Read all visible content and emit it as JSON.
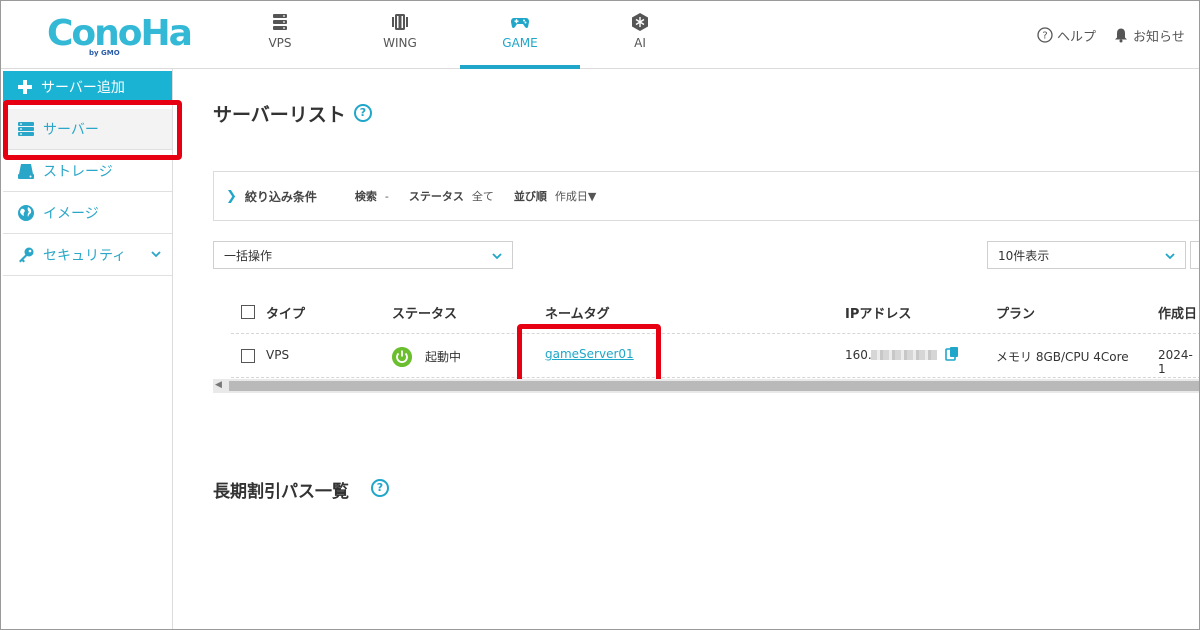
{
  "header": {
    "logo_text": "ConoHa",
    "logo_sub": "by GMO",
    "tabs": [
      {
        "label": "VPS",
        "icon": "server-stack-icon"
      },
      {
        "label": "WING",
        "icon": "wing-server-icon"
      },
      {
        "label": "GAME",
        "icon": "gamepad-icon",
        "active": true
      },
      {
        "label": "AI",
        "icon": "ai-chip-icon"
      }
    ],
    "help_label": "ヘルプ",
    "notice_label": "お知らせ"
  },
  "sidebar": {
    "add_server": "サーバー追加",
    "items": [
      {
        "label": "サーバー",
        "icon": "server-icon",
        "active": true
      },
      {
        "label": "ストレージ",
        "icon": "storage-icon"
      },
      {
        "label": "イメージ",
        "icon": "globe-icon"
      },
      {
        "label": "セキュリティ",
        "icon": "key-icon"
      }
    ]
  },
  "main": {
    "title": "サーバーリスト",
    "help_mark": "?",
    "filter": {
      "title": "絞り込み条件",
      "search_key": "検索",
      "search_val": "-",
      "status_key": "ステータス",
      "status_val": "全て",
      "sort_key": "並び順",
      "sort_val": "作成日▼"
    },
    "bulk_action": "一括操作",
    "per_page": "10件表示",
    "table": {
      "headers": [
        "タイプ",
        "ステータス",
        "ネームタグ",
        "IPアドレス",
        "プラン",
        "作成日"
      ],
      "rows": [
        {
          "type": "VPS",
          "status": "起動中",
          "name_tag": "gameServer01",
          "ip_prefix": "160.",
          "plan": "メモリ 8GB/CPU 4Core",
          "created": "2024-1"
        }
      ]
    },
    "section2_title": "長期割引パス一覧"
  },
  "colors": {
    "accent": "#1fa6c9",
    "sidebar_add": "#1bb3d3",
    "running": "#6bbf2f",
    "highlight": "#e60012"
  }
}
